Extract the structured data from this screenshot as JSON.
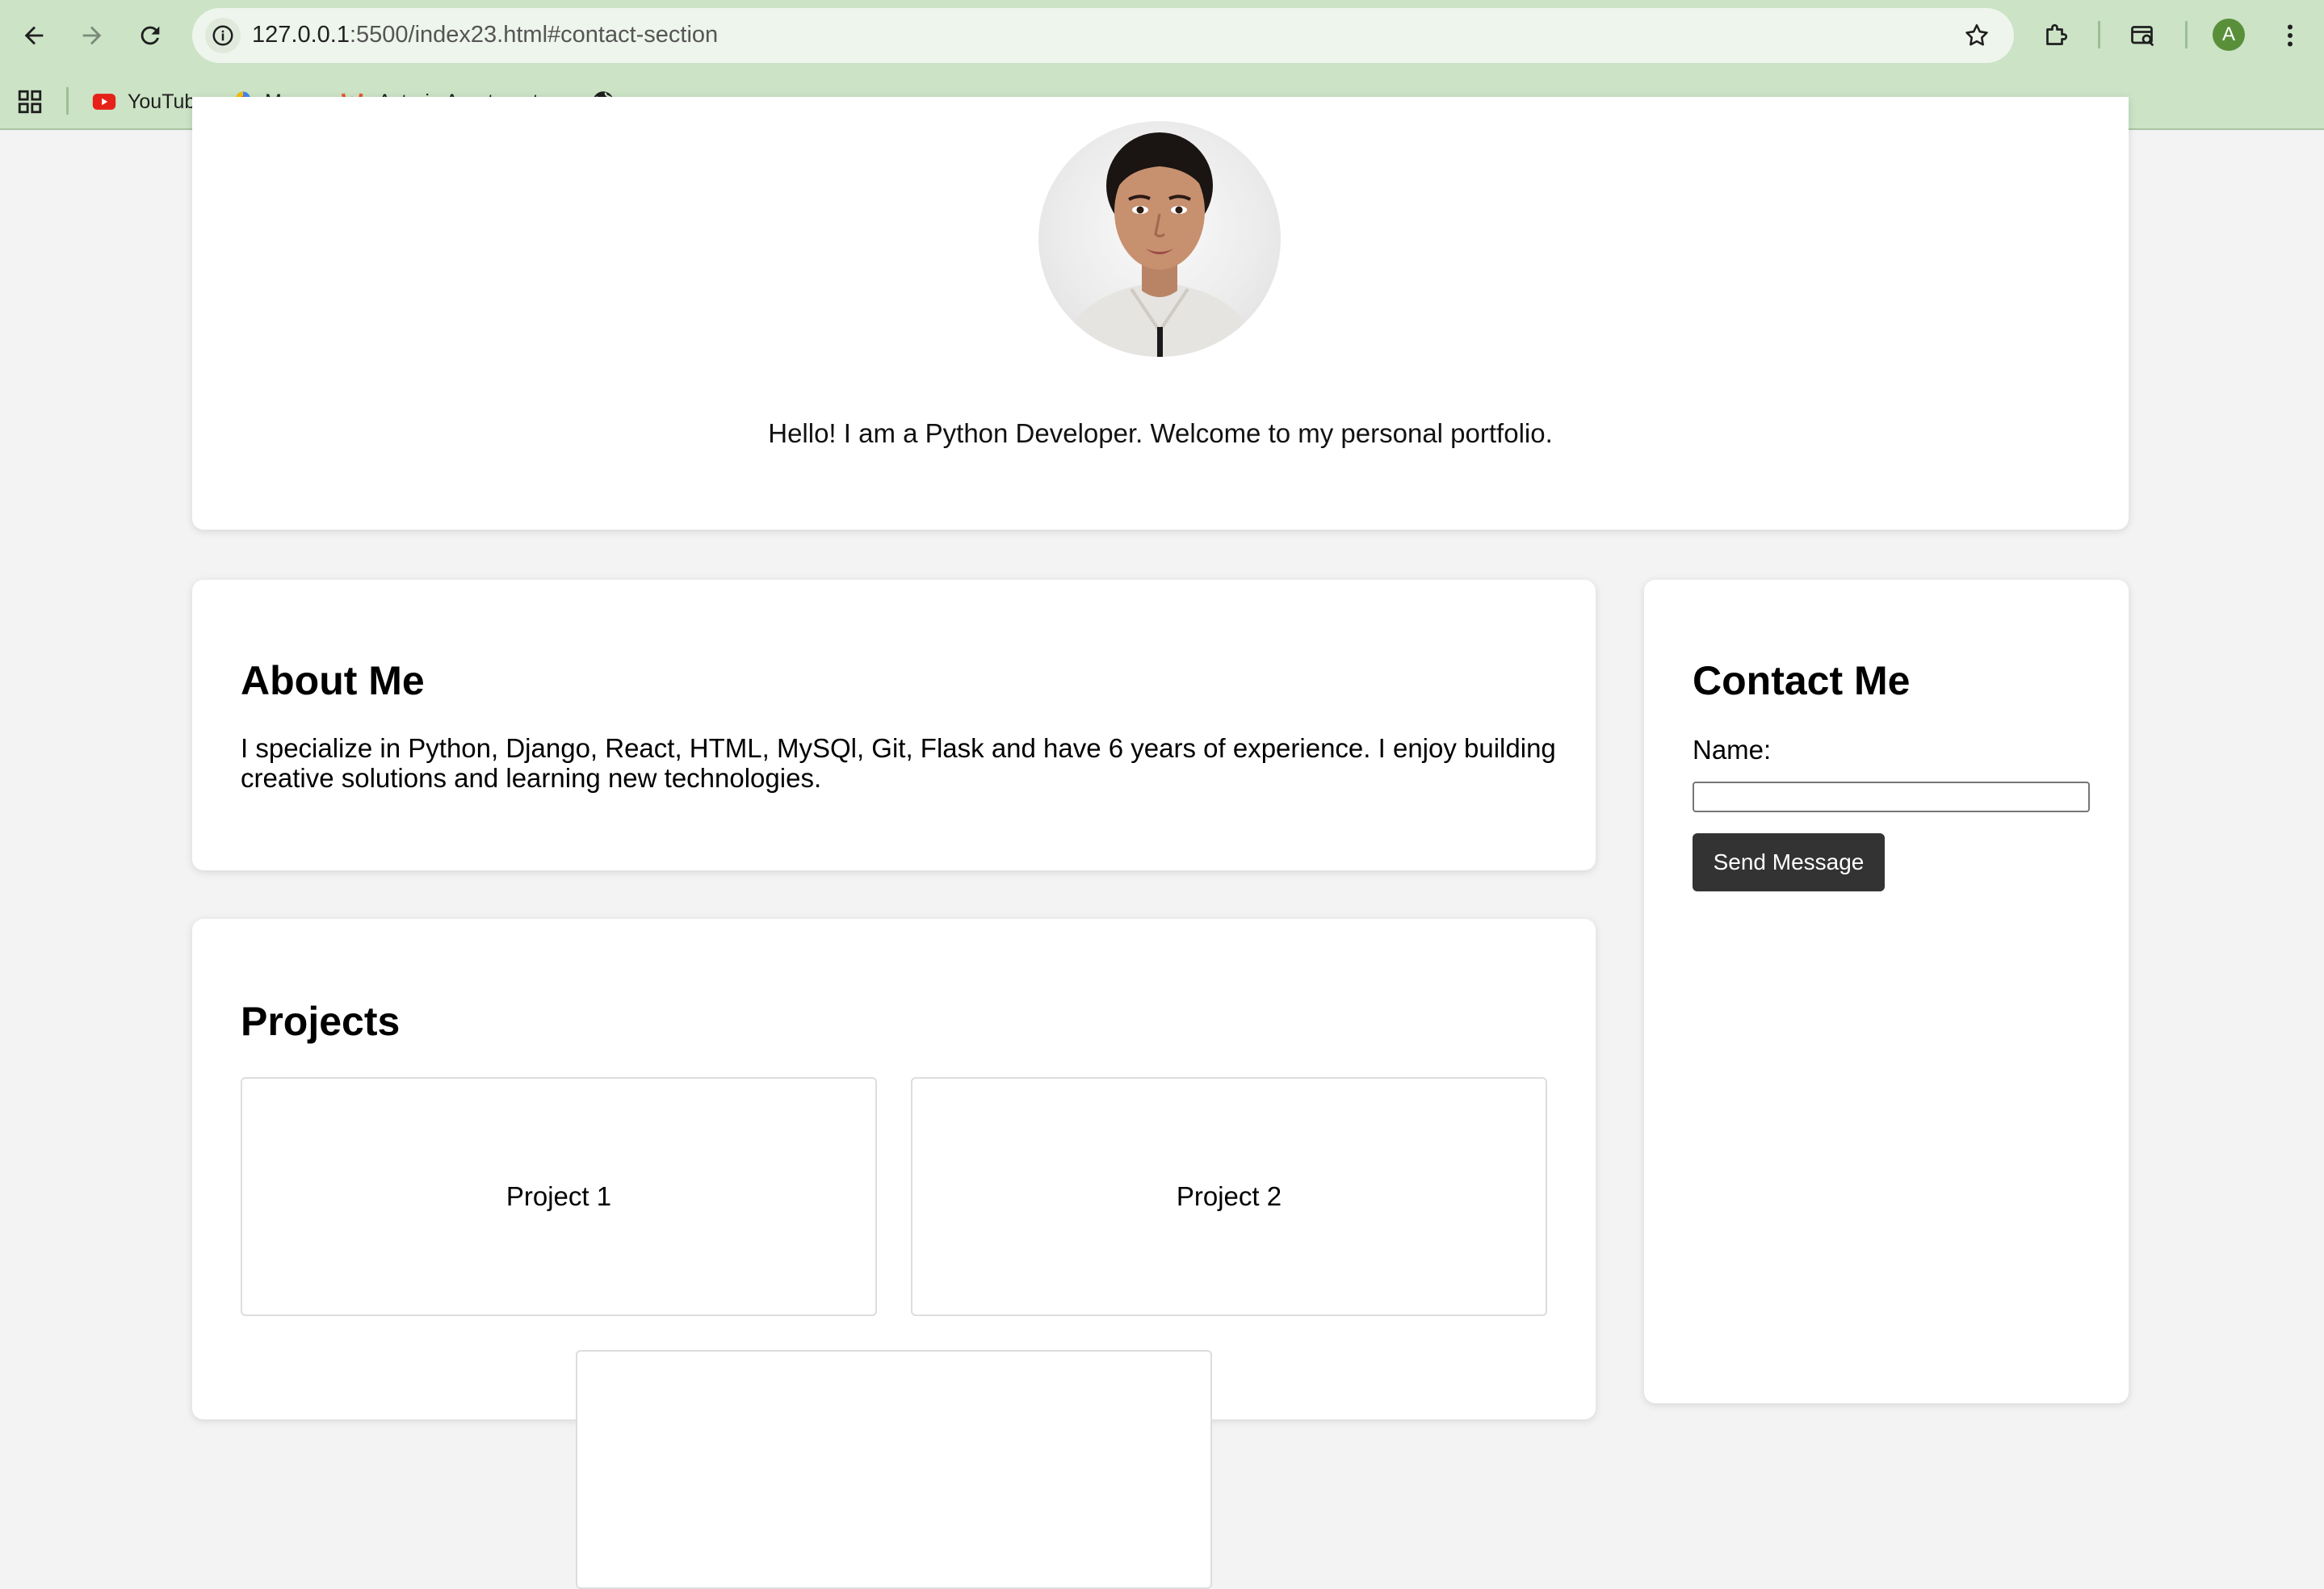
{
  "browser": {
    "url_host": "127.0.0.1",
    "url_path": ":5500/index23.html#contact-section",
    "profile_initial": "A",
    "bookmarks": [
      {
        "label": "YouTube",
        "icon": "youtube-icon"
      },
      {
        "label": "Maps",
        "icon": "maps-icon"
      },
      {
        "label": "Asteria Apartment...",
        "icon": "asteria-w-icon"
      },
      {
        "label": "",
        "icon": "globe-icon"
      }
    ]
  },
  "hero": {
    "tagline": "Hello! I am a Python Developer. Welcome to my personal portfolio."
  },
  "about": {
    "title": "About Me",
    "text": "I specialize in Python, Django, React, HTML, MySQl, Git, Flask and have 6 years of experience. I enjoy building creative solutions and learning new technologies."
  },
  "contact": {
    "title": "Contact Me",
    "name_label": "Name:",
    "name_value": "",
    "send_label": "Send Message"
  },
  "projects": {
    "title": "Projects",
    "items": [
      {
        "label": "Project 1"
      },
      {
        "label": "Project 2"
      },
      {
        "label": ""
      }
    ]
  },
  "colors": {
    "chrome_bg": "#cce3c6",
    "page_bg": "#f3f3f3",
    "button_bg": "#333333"
  }
}
